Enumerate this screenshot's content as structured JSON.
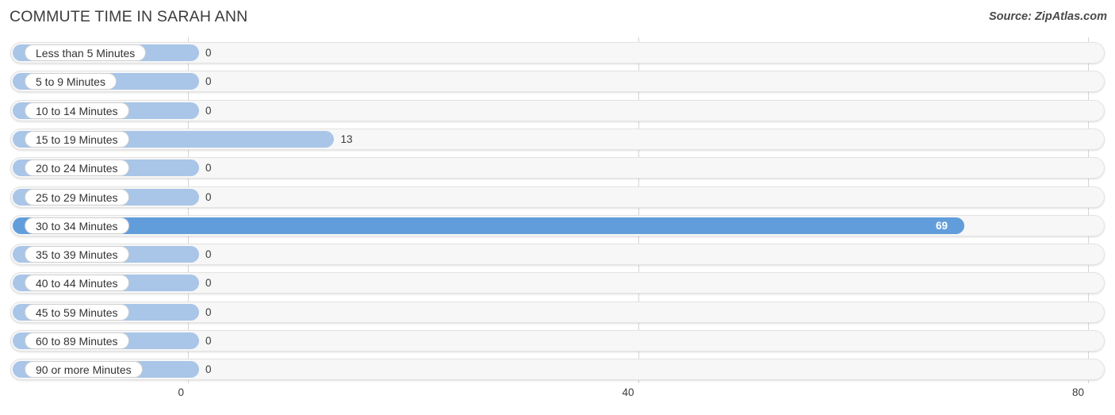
{
  "header": {
    "title": "COMMUTE TIME IN SARAH ANN",
    "source": "Source: ZipAtlas.com"
  },
  "colors": {
    "bar_light": "#a9c5e8",
    "bar_dark": "#629ddb",
    "track_fill": "#f7f7f7",
    "track_border": "#e3e3e3",
    "gridline": "#d6d6d6",
    "text": "#3b3b3b"
  },
  "chart_data": {
    "type": "bar",
    "orientation": "horizontal",
    "title": "COMMUTE TIME IN SARAH ANN",
    "xlabel": "",
    "ylabel": "",
    "xlim": [
      0,
      80
    ],
    "xticks": [
      "0",
      "40",
      "80"
    ],
    "xtick_values": [
      0,
      40,
      80
    ],
    "grid": true,
    "legend": false,
    "categories": [
      "Less than 5 Minutes",
      "5 to 9 Minutes",
      "10 to 14 Minutes",
      "15 to 19 Minutes",
      "20 to 24 Minutes",
      "25 to 29 Minutes",
      "30 to 34 Minutes",
      "35 to 39 Minutes",
      "40 to 44 Minutes",
      "45 to 59 Minutes",
      "60 to 89 Minutes",
      "90 or more Minutes"
    ],
    "values": [
      0,
      0,
      0,
      13,
      0,
      0,
      69,
      0,
      0,
      0,
      0,
      0
    ],
    "value_labels": [
      "0",
      "0",
      "0",
      "13",
      "0",
      "0",
      "69",
      "0",
      "0",
      "0",
      "0",
      "0"
    ],
    "highlight_index": 6
  }
}
